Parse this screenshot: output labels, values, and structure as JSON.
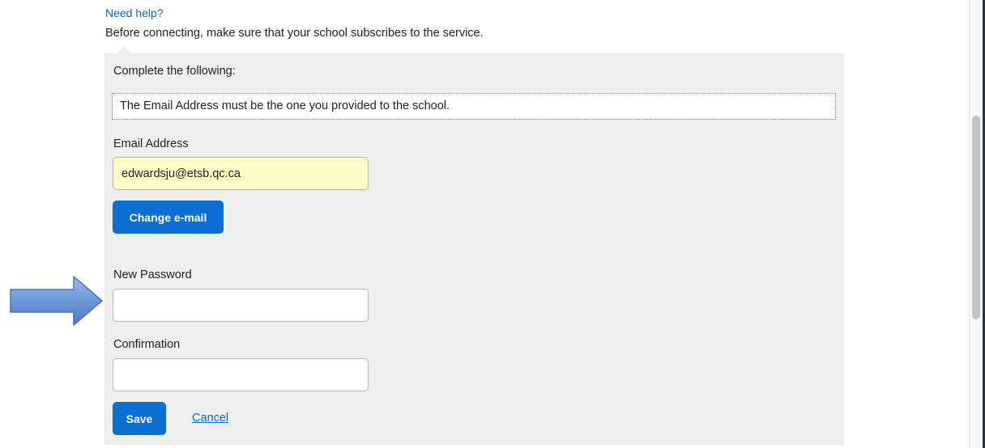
{
  "header": {
    "help_link": "Need help?",
    "intro": "Before connecting, make sure that your school subscribes to the service."
  },
  "form": {
    "section_label": "Complete the following:",
    "notice": "The Email Address must be the one you provided to the school.",
    "email": {
      "label": "Email Address",
      "value": "edwardsju@etsb.qc.ca"
    },
    "change_email_button": "Change e-mail",
    "new_password": {
      "label": "New Password",
      "value": ""
    },
    "confirmation": {
      "label": "Confirmation",
      "value": ""
    },
    "save_button": "Save",
    "cancel_link": "Cancel"
  },
  "annotation": {
    "icon": "arrow-right-icon",
    "color": "#6c97d8"
  },
  "colors": {
    "accent": "#0a6fd1",
    "link": "#1565c0",
    "panel": "#eeeeee",
    "autofill": "#fbfcc4"
  }
}
